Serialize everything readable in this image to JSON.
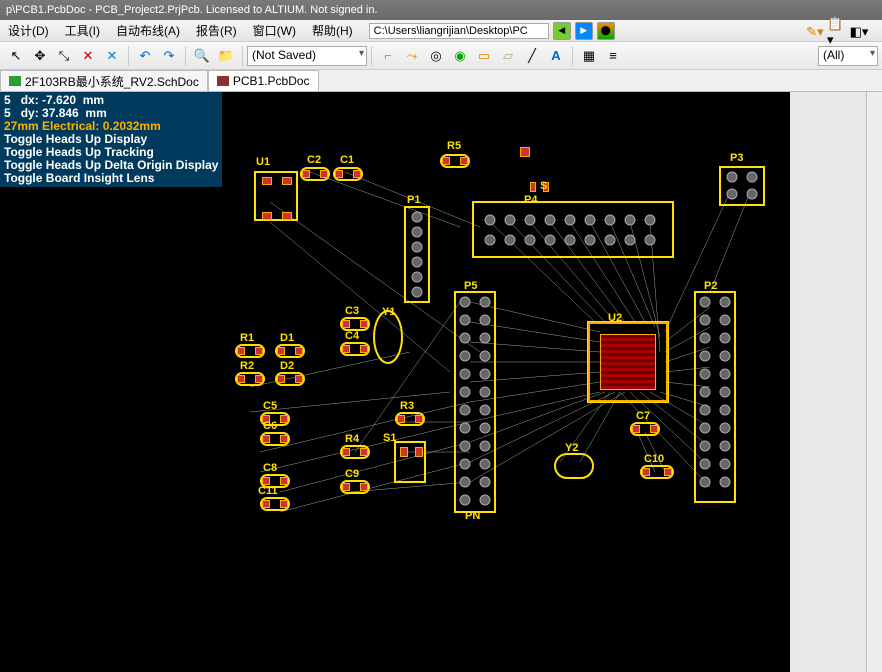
{
  "title": "p\\PCB1.PcbDoc - PCB_Project2.PrjPcb. Licensed to ALTIUM. Not signed in.",
  "menu": {
    "design": "设计(D)",
    "tool": "工具(I)",
    "autoroute": "自动布线(A)",
    "report": "报告(R)",
    "window": "窗口(W)",
    "help": "帮助(H)"
  },
  "path": "C:\\Users\\liangrijian\\Desktop\\PC",
  "saved_state": "(Not Saved)",
  "filter": "(All)",
  "tabs": {
    "t1": "2F103RB最小系统_RV2.SchDoc",
    "t2": "PCB1.PcbDoc"
  },
  "hud": {
    "dx_label": "dx:",
    "dx": "-7.620",
    "dy_label": "dy:",
    "dy": "37.846",
    "unit": "mm",
    "grid": "27mm Electrical: 0.2032mm",
    "l1": "Toggle Heads Up Display",
    "l2": "Toggle Heads Up Tracking",
    "l3": "Toggle Heads Up Delta Origin Display",
    "l4": "Toggle Board Insight Lens"
  },
  "designators": {
    "u1": "U1",
    "u2": "U2",
    "c1": "C1",
    "c2": "C2",
    "c3": "C3",
    "c4": "C4",
    "c5": "C5",
    "c6": "C6",
    "c7": "C7",
    "c8": "C8",
    "c9": "C9",
    "c10": "C10",
    "c11": "C11",
    "r1": "R1",
    "r2": "R2",
    "r3": "R3",
    "r4": "R4",
    "r5": "R5",
    "d1": "D1",
    "d2": "D2",
    "s1": "S1",
    "y1": "Y1",
    "y2": "Y2",
    "p1": "P1",
    "p2": "P2",
    "p3": "P3",
    "p4": "P4",
    "p5": "P5",
    "ps": "P5",
    "pn": "PN",
    "s": "S"
  }
}
